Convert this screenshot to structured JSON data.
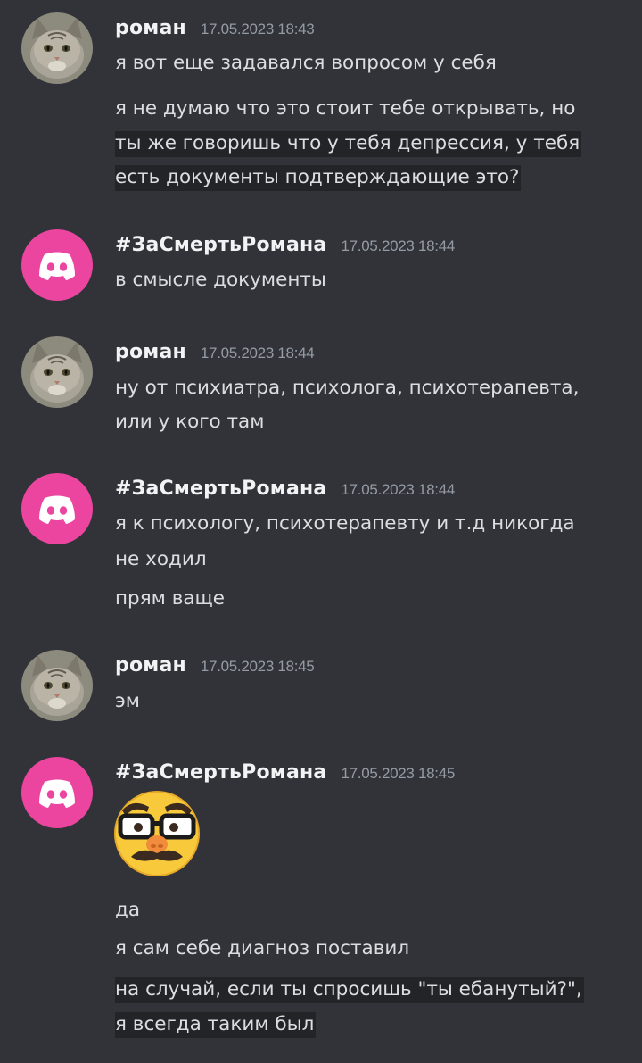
{
  "messages": [
    {
      "author": "роман",
      "avatar_icon": "cat-avatar-icon",
      "timestamp": "17.05.2023 18:43",
      "lines": [
        "я вот еще задавался вопросом у себя",
        "я не думаю что это стоит тебе открывать, но",
        "ты же говоришь что у тебя депрессия, у тебя",
        "есть документы подтверждающие это?"
      ]
    },
    {
      "author": "#ЗаСмертьРомана",
      "avatar_icon": "discord-logo-icon",
      "timestamp": "17.05.2023 18:44",
      "lines": [
        "в смысле документы"
      ]
    },
    {
      "author": "роман",
      "avatar_icon": "cat-avatar-icon",
      "timestamp": "17.05.2023 18:44",
      "lines": [
        "ну от психиатра, психолога, психотерапевта,",
        "или у кого там"
      ]
    },
    {
      "author": "#ЗаСмертьРомана",
      "avatar_icon": "discord-logo-icon",
      "timestamp": "17.05.2023 18:44",
      "lines": [
        "я к психологу, психотерапевту и т.д никогда",
        "не ходил",
        "прям ваще"
      ]
    },
    {
      "author": "роман",
      "avatar_icon": "cat-avatar-icon",
      "timestamp": "17.05.2023 18:45",
      "lines": [
        "эм"
      ]
    },
    {
      "author": "#ЗаСмертьРомана",
      "avatar_icon": "discord-logo-icon",
      "timestamp": "17.05.2023 18:45",
      "emoji": "disguised-face-emoji",
      "lines": [
        "да",
        "я сам себе диагноз поставил",
        "на случай, если ты спросишь \"ты ебанутый?\",",
        "я всегда таким был"
      ]
    }
  ],
  "colors": {
    "background": "#313338",
    "username": "#f2f3f5",
    "text": "#dbdee1",
    "timestamp": "#949ba4",
    "highlight": "#232428",
    "discord_avatar_bg": "#eb459f"
  }
}
